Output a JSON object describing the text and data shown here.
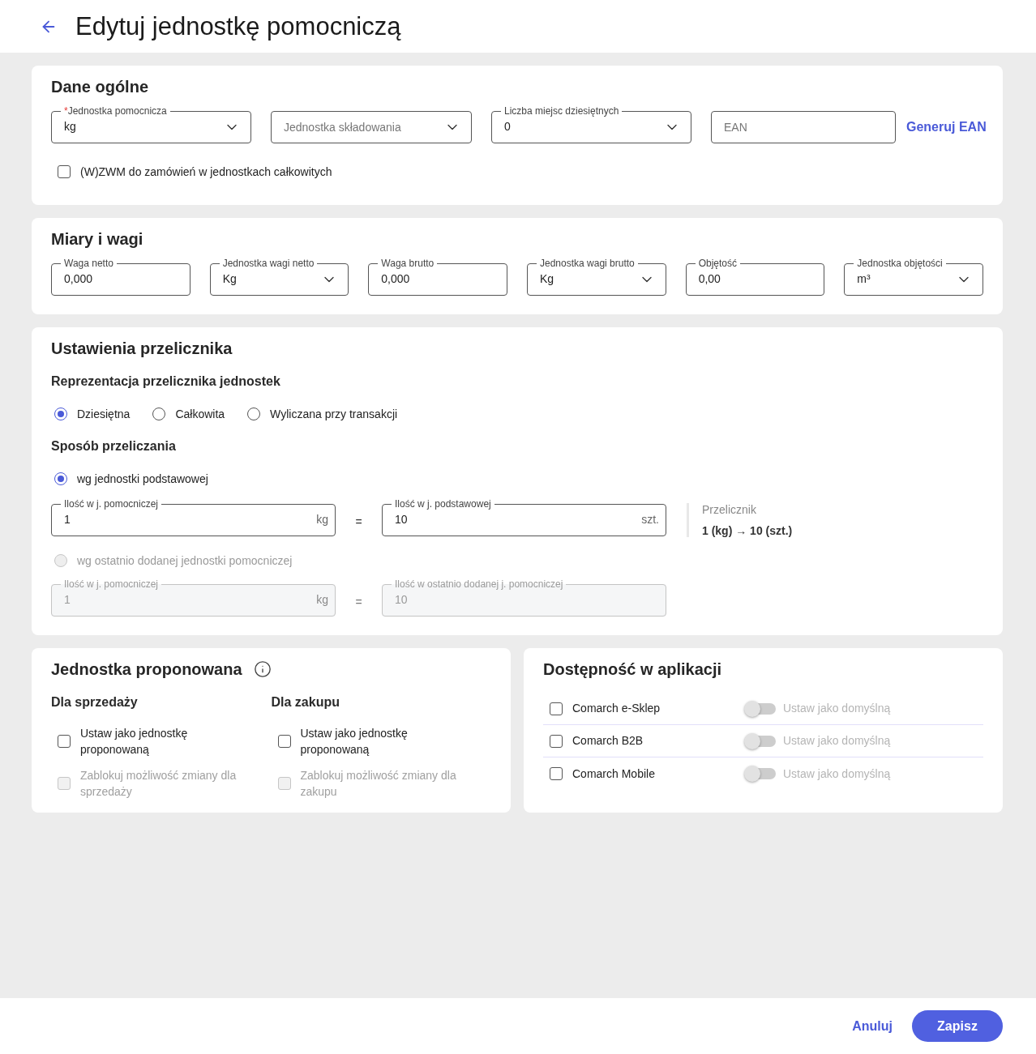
{
  "header": {
    "title": "Edytuj jednostkę pomocniczą"
  },
  "general": {
    "title": "Dane ogólne",
    "fields": [
      {
        "kind": "select",
        "required_mark": "*",
        "label": "Jednostka pomocnicza",
        "value": "kg"
      },
      {
        "kind": "select",
        "placeholder": "Jednostka składowania"
      },
      {
        "kind": "select",
        "label": "Liczba miejsc dziesiętnych",
        "value": "0"
      },
      {
        "kind": "input",
        "placeholder": "EAN"
      }
    ],
    "generate_link": "Generuj EAN",
    "checkbox": {
      "label": "(W)ZWM do zamówień w jednostkach całkowitych",
      "checked": false
    }
  },
  "measures": {
    "title": "Miary i wagi",
    "fields": [
      {
        "kind": "input",
        "label": "Waga netto",
        "value": "0,000"
      },
      {
        "kind": "select",
        "label": "Jednostka wagi netto",
        "value": "Kg"
      },
      {
        "kind": "input",
        "label": "Waga brutto",
        "value": "0,000"
      },
      {
        "kind": "select",
        "label": "Jednostka wagi brutto",
        "value": "Kg"
      },
      {
        "kind": "input",
        "label": "Objętość",
        "value": "0,00"
      },
      {
        "kind": "select",
        "label": "Jednostka objętości",
        "value": "m³"
      }
    ]
  },
  "converter": {
    "title": "Ustawienia przelicznika",
    "representation": {
      "title": "Reprezentacja przelicznika jednostek",
      "options": [
        {
          "label": "Dziesiętna",
          "selected": true
        },
        {
          "label": "Całkowita",
          "selected": false
        },
        {
          "label": "Wyliczana przy transakcji",
          "selected": false
        }
      ]
    },
    "method": {
      "title": "Sposób przeliczania",
      "options": [
        {
          "label": "wg jednostki podstawowej",
          "selected": true,
          "disabled": false,
          "fields": [
            {
              "kind": "input",
              "label": "Ilość w j. pomocniczej",
              "value": "1",
              "unit": "kg"
            },
            {
              "kind": "input",
              "label": "Ilość w j. podstawowej",
              "value": "10",
              "unit": "szt."
            }
          ],
          "equals": "=",
          "summary": {
            "label": "Przelicznik",
            "value": "1 (kg) → 10 (szt.)"
          }
        },
        {
          "label": "wg ostatnio dodanej jednostki pomocniczej",
          "selected": false,
          "disabled": true,
          "fields": [
            {
              "kind": "input",
              "label": "Ilość w j. pomocniczej",
              "value": "1",
              "unit": "kg"
            },
            {
              "kind": "input",
              "label": "Ilość w ostatnio dodanej j. pomocniczej",
              "value": "10"
            }
          ],
          "equals": "="
        }
      ]
    }
  },
  "proposed": {
    "title": "Jednostka proponowana",
    "columns": [
      {
        "title": "Dla sprzedaży",
        "options": [
          {
            "label": "Ustaw jako jednostkę proponowaną",
            "checked": false,
            "disabled": false
          },
          {
            "label": "Zablokuj możliwość zmiany dla sprzedaży",
            "checked": false,
            "disabled": true
          }
        ]
      },
      {
        "title": "Dla zakupu",
        "options": [
          {
            "label": "Ustaw jako jednostkę proponowaną",
            "checked": false,
            "disabled": false
          },
          {
            "label": "Zablokuj możliwość zmiany dla zakupu",
            "checked": false,
            "disabled": true
          }
        ]
      }
    ]
  },
  "availability": {
    "title": "Dostępność w aplikacji",
    "apps": [
      {
        "name": "Comarch e-Sklep",
        "checked": false,
        "default": {
          "label": "Ustaw jako domyślną",
          "on": false,
          "disabled": true
        }
      },
      {
        "name": "Comarch B2B",
        "checked": false,
        "default": {
          "label": "Ustaw jako domyślną",
          "on": false,
          "disabled": true
        }
      },
      {
        "name": "Comarch Mobile",
        "checked": false,
        "default": {
          "label": "Ustaw jako domyślną",
          "on": false,
          "disabled": true
        }
      }
    ]
  },
  "footer": {
    "cancel": "Anuluj",
    "save": "Zapisz"
  }
}
